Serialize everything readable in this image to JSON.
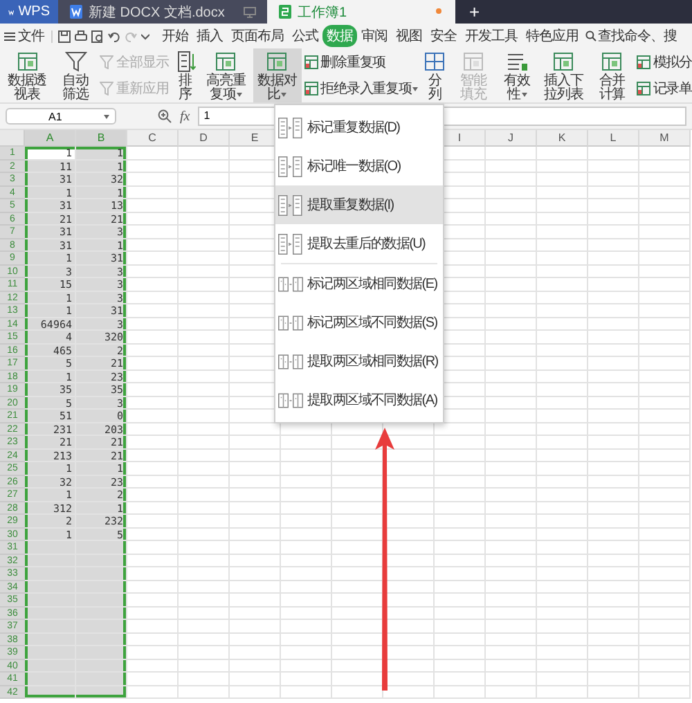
{
  "title_bar": {
    "app": "WPS",
    "documents": [
      {
        "name": "新建 DOCX 文档.docx",
        "kind": "doc",
        "selected": false,
        "unsaved": false
      },
      {
        "name": "工作簿1",
        "kind": "sheet",
        "selected": true,
        "unsaved": true
      }
    ],
    "new_tab": "+"
  },
  "menu": {
    "file": "文件",
    "tabs": [
      {
        "label": "开始",
        "selected": false
      },
      {
        "label": "插入",
        "selected": false
      },
      {
        "label": "页面布局",
        "selected": false
      },
      {
        "label": "公式",
        "selected": false
      },
      {
        "label": "数据",
        "selected": true
      },
      {
        "label": "审阅",
        "selected": false
      },
      {
        "label": "视图",
        "selected": false
      },
      {
        "label": "安全",
        "selected": false
      },
      {
        "label": "开发工具",
        "selected": false
      },
      {
        "label": "特色应用",
        "selected": false
      }
    ],
    "search": "查找命令、搜"
  },
  "ribbon": [
    {
      "kind": "large",
      "label": "数据透视表",
      "disabled": false,
      "dropdown": false,
      "pressed": false
    },
    {
      "kind": "large",
      "label": "自动筛选",
      "disabled": false,
      "dropdown": false,
      "pressed": false
    },
    {
      "kind": "stack",
      "items": [
        {
          "label": "全部显示",
          "disabled": true,
          "dropdown": false
        },
        {
          "label": "重新应用",
          "disabled": true,
          "dropdown": false
        }
      ]
    },
    {
      "kind": "large",
      "label": "排序",
      "disabled": false,
      "dropdown": false,
      "pressed": false
    },
    {
      "kind": "large",
      "label": "高亮重复项",
      "disabled": false,
      "dropdown": true,
      "pressed": false
    },
    {
      "kind": "large",
      "label": "数据对比",
      "disabled": false,
      "dropdown": true,
      "pressed": true
    },
    {
      "kind": "stack",
      "items": [
        {
          "label": "删除重复项",
          "disabled": false,
          "dropdown": false
        },
        {
          "label": "拒绝录入重复项",
          "disabled": false,
          "dropdown": true
        }
      ]
    },
    {
      "kind": "large",
      "label": "分列",
      "disabled": false,
      "dropdown": false,
      "pressed": false
    },
    {
      "kind": "large",
      "label": "智能填充",
      "disabled": true,
      "dropdown": false,
      "pressed": false
    },
    {
      "kind": "large",
      "label": "有效性",
      "disabled": false,
      "dropdown": true,
      "pressed": false
    },
    {
      "kind": "large",
      "label": "插入下拉列表",
      "disabled": false,
      "dropdown": false,
      "pressed": false
    },
    {
      "kind": "large",
      "label": "合并计算",
      "disabled": false,
      "dropdown": false,
      "pressed": false
    },
    {
      "kind": "stack",
      "items": [
        {
          "label": "模拟分",
          "disabled": false,
          "dropdown": false
        },
        {
          "label": "记录单",
          "disabled": false,
          "dropdown": false
        }
      ]
    }
  ],
  "formula_bar": {
    "cell": "A1",
    "fx": "fx",
    "value": "1"
  },
  "columns": [
    {
      "label": "A",
      "selected": true
    },
    {
      "label": "B",
      "selected": true
    },
    {
      "label": "C",
      "selected": false
    },
    {
      "label": "D",
      "selected": false
    },
    {
      "label": "E",
      "selected": false
    },
    {
      "label": "I",
      "selected": false
    },
    {
      "label": "J",
      "selected": false
    },
    {
      "label": "K",
      "selected": false
    },
    {
      "label": "L",
      "selected": false
    },
    {
      "label": "M",
      "selected": false
    }
  ],
  "row_headers": [
    "1",
    "2",
    "3",
    "4",
    "5",
    "6",
    "7",
    "8",
    "9",
    "10",
    "11",
    "12",
    "13",
    "14",
    "15",
    "16",
    "17",
    "18",
    "19",
    "20",
    "21",
    "22",
    "23",
    "24",
    "25",
    "26",
    "27",
    "28",
    "29",
    "30",
    "31",
    "32",
    "33",
    "34",
    "35",
    "36",
    "37",
    "38",
    "39",
    "40",
    "41",
    "42"
  ],
  "rows": [
    {
      "a": "1",
      "b": "1",
      "active": true
    },
    {
      "a": "11",
      "b": "1",
      "active": false
    },
    {
      "a": "31",
      "b": "32",
      "active": false
    },
    {
      "a": "1",
      "b": "1",
      "active": false
    },
    {
      "a": "31",
      "b": "13",
      "active": false
    },
    {
      "a": "21",
      "b": "21",
      "active": false
    },
    {
      "a": "31",
      "b": "3",
      "active": false
    },
    {
      "a": "31",
      "b": "1",
      "active": false
    },
    {
      "a": "1",
      "b": "31",
      "active": false
    },
    {
      "a": "3",
      "b": "3",
      "active": false
    },
    {
      "a": "15",
      "b": "3",
      "active": false
    },
    {
      "a": "1",
      "b": "3",
      "active": false
    },
    {
      "a": "1",
      "b": "31",
      "active": false
    },
    {
      "a": "64964",
      "b": "3",
      "active": false
    },
    {
      "a": "4",
      "b": "320",
      "active": false
    },
    {
      "a": "465",
      "b": "2",
      "active": false
    },
    {
      "a": "5",
      "b": "21",
      "active": false
    },
    {
      "a": "1",
      "b": "23",
      "active": false
    },
    {
      "a": "35",
      "b": "35",
      "active": false
    },
    {
      "a": "5",
      "b": "3",
      "active": false
    },
    {
      "a": "51",
      "b": "0",
      "active": false
    },
    {
      "a": "231",
      "b": "203",
      "active": false
    },
    {
      "a": "21",
      "b": "21",
      "active": false
    },
    {
      "a": "213",
      "b": "21",
      "active": false
    },
    {
      "a": "1",
      "b": "1",
      "active": false
    },
    {
      "a": "32",
      "b": "23",
      "active": false
    },
    {
      "a": "1",
      "b": "2",
      "active": false
    },
    {
      "a": "312",
      "b": "1",
      "active": false
    },
    {
      "a": "2",
      "b": "232",
      "active": false
    },
    {
      "a": "1",
      "b": "5",
      "active": false
    }
  ],
  "dropdown_menu": {
    "groups": [
      [
        {
          "label": "标记重复数据(D)",
          "kind": "single",
          "selected": false
        },
        {
          "label": "标记唯一数据(O)",
          "kind": "single",
          "selected": false
        },
        {
          "label": "提取重复数据(I)",
          "kind": "single",
          "selected": true
        },
        {
          "label": "提取去重后的数据(U)",
          "kind": "single",
          "selected": false
        }
      ],
      [
        {
          "label": "标记两区域相同数据(E)",
          "kind": "pair",
          "selected": false
        },
        {
          "label": "标记两区域不同数据(S)",
          "kind": "pair",
          "selected": false
        },
        {
          "label": "提取两区域相同数据(R)",
          "kind": "pair",
          "selected": false
        },
        {
          "label": "提取两区域不同数据(A)",
          "kind": "pair",
          "selected": false
        }
      ]
    ]
  }
}
